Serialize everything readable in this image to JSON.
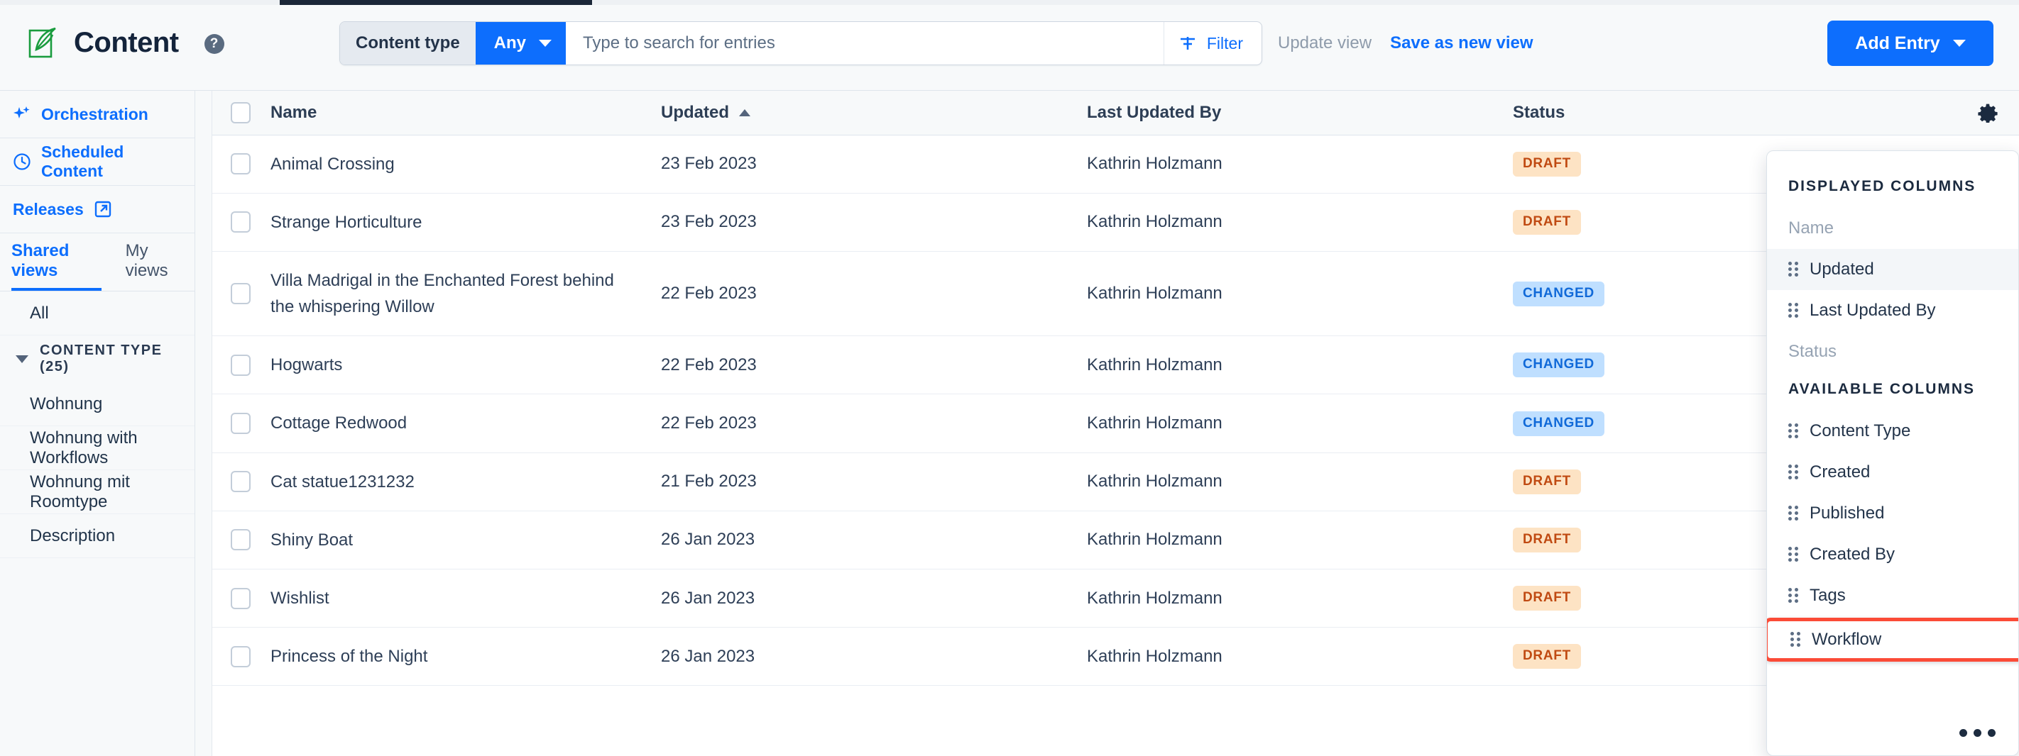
{
  "header": {
    "title": "Content",
    "help_icon": "help-circle-icon",
    "logo_icon": "content-leaf-icon"
  },
  "toolbar": {
    "content_type_label": "Content type",
    "content_type_value": "Any",
    "search_placeholder": "Type to search for entries",
    "filter_label": "Filter",
    "update_view_label": "Update view",
    "save_as_new_view_label": "Save as new view",
    "add_entry_label": "Add Entry"
  },
  "sidebar": {
    "links": [
      {
        "label": "Orchestration",
        "icon": "sparkles-icon"
      },
      {
        "label": "Scheduled Content",
        "icon": "clock-icon"
      },
      {
        "label": "Releases",
        "icon": "external-link-icon"
      }
    ],
    "tabs": [
      {
        "label": "Shared views",
        "active": true
      },
      {
        "label": "My views",
        "active": false
      }
    ],
    "all_label": "All",
    "group": {
      "label": "CONTENT TYPE (25)",
      "items": [
        {
          "label": "Wohnung"
        },
        {
          "label": "Wohnung with Workflows"
        },
        {
          "label": "Wohnung mit Roomtype"
        },
        {
          "label": "Description"
        }
      ]
    }
  },
  "table": {
    "columns": [
      {
        "key": "name",
        "label": "Name"
      },
      {
        "key": "updated",
        "label": "Updated",
        "sorted": "asc"
      },
      {
        "key": "last_updated_by",
        "label": "Last Updated By"
      },
      {
        "key": "status",
        "label": "Status"
      }
    ],
    "settings_icon": "gear-icon",
    "rows": [
      {
        "name": "Animal Crossing",
        "updated": "23 Feb 2023",
        "last_updated_by": "Kathrin Holzmann",
        "status": "DRAFT"
      },
      {
        "name": "Strange Horticulture",
        "updated": "23 Feb 2023",
        "last_updated_by": "Kathrin Holzmann",
        "status": "DRAFT"
      },
      {
        "name": "Villa Madrigal in the Enchanted Forest behind the whispering Willow",
        "updated": "22 Feb 2023",
        "last_updated_by": "Kathrin Holzmann",
        "status": "CHANGED"
      },
      {
        "name": "Hogwarts",
        "updated": "22 Feb 2023",
        "last_updated_by": "Kathrin Holzmann",
        "status": "CHANGED"
      },
      {
        "name": "Cottage Redwood",
        "updated": "22 Feb 2023",
        "last_updated_by": "Kathrin Holzmann",
        "status": "CHANGED"
      },
      {
        "name": "Cat statue1231232",
        "updated": "21 Feb 2023",
        "last_updated_by": "Kathrin Holzmann",
        "status": "DRAFT"
      },
      {
        "name": "Shiny Boat",
        "updated": "26 Jan 2023",
        "last_updated_by": "Kathrin Holzmann",
        "status": "DRAFT"
      },
      {
        "name": "Wishlist",
        "updated": "26 Jan 2023",
        "last_updated_by": "Kathrin Holzmann",
        "status": "DRAFT"
      },
      {
        "name": "Princess of the Night",
        "updated": "26 Jan 2023",
        "last_updated_by": "Kathrin Holzmann",
        "status": "DRAFT"
      }
    ]
  },
  "columns_popover": {
    "displayed_heading": "DISPLAYED COLUMNS",
    "displayed": [
      {
        "label": "Name",
        "draggable": false,
        "highlight": false
      },
      {
        "label": "Updated",
        "draggable": true,
        "highlight": true
      },
      {
        "label": "Last Updated By",
        "draggable": true,
        "highlight": false
      },
      {
        "label": "Status",
        "draggable": false,
        "highlight": false
      }
    ],
    "available_heading": "AVAILABLE COLUMNS",
    "available": [
      {
        "label": "Content Type",
        "draggable": true,
        "selected": false
      },
      {
        "label": "Created",
        "draggable": true,
        "selected": false
      },
      {
        "label": "Published",
        "draggable": true,
        "selected": false
      },
      {
        "label": "Created By",
        "draggable": true,
        "selected": false
      },
      {
        "label": "Tags",
        "draggable": true,
        "selected": false
      },
      {
        "label": "Workflow",
        "draggable": true,
        "selected": true
      }
    ],
    "more_icon": "more-horizontal-icon"
  },
  "colors": {
    "accent_blue": "#0d6efd",
    "highlight_red": "#fb4b37",
    "draft_badge_bg": "#fde3c4",
    "draft_badge_text": "#c04a12",
    "changed_badge_bg": "#bfdfff",
    "changed_badge_text": "#1069d8",
    "logo_green": "#1a9c3e"
  }
}
